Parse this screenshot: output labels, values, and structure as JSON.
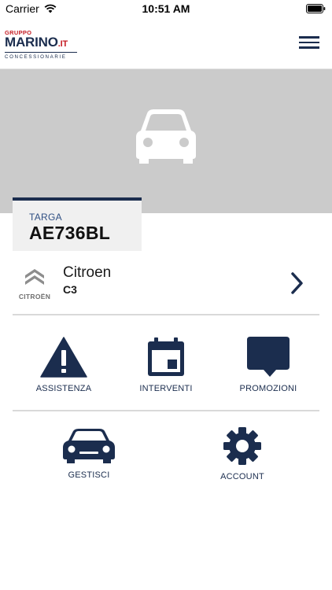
{
  "status_bar": {
    "carrier": "Carrier",
    "time": "10:51 AM"
  },
  "header": {
    "logo": {
      "top": "GRUPPO",
      "main": "MARINO",
      "suffix": ".IT",
      "sub": "CONCESSIONARIE"
    },
    "menu_icon": "hamburger-icon"
  },
  "hero": {
    "placeholder_icon": "car-icon"
  },
  "plate": {
    "label": "TARGA",
    "number": "AE736BL"
  },
  "vehicle": {
    "brand": "Citroen",
    "model": "C3",
    "brand_logo_text": "CITROËN"
  },
  "actions_row1": [
    {
      "label": "ASSISTENZA",
      "icon": "warning-icon"
    },
    {
      "label": "INTERVENTI",
      "icon": "calendar-icon"
    },
    {
      "label": "PROMOZIONI",
      "icon": "chat-bubble-icon"
    }
  ],
  "actions_row2": [
    {
      "label": "GESTISCI",
      "icon": "car-icon"
    },
    {
      "label": "ACCOUNT",
      "icon": "gear-icon"
    }
  ],
  "colors": {
    "navy": "#1b2d4e",
    "brand_red": "#c51d24",
    "hero_gray": "#cbcbcb"
  }
}
